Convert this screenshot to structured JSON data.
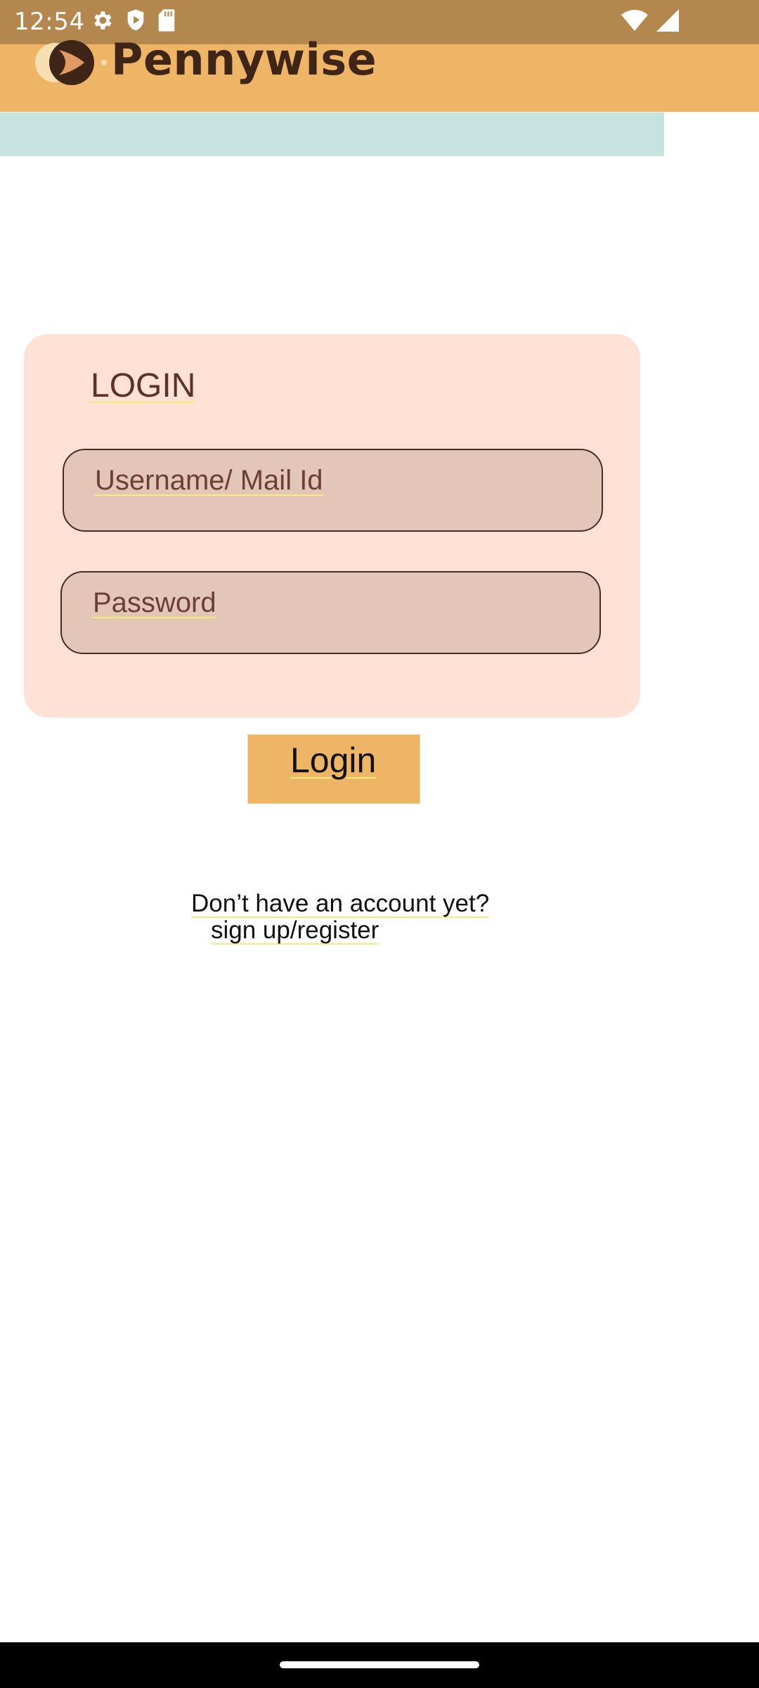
{
  "status_bar": {
    "time": "12:54",
    "left_icons": [
      "gear-icon",
      "shield-icon",
      "sd-card-icon"
    ],
    "right_icons": [
      "wifi-icon",
      "cell-signal-icon"
    ]
  },
  "app_header": {
    "title": "Pennywise",
    "logo": "pennywise-logo-icon"
  },
  "login_card": {
    "title": "LOGIN",
    "username_placeholder": "Username/ Mail Id",
    "password_placeholder": "Password"
  },
  "login_button": {
    "label": "Login"
  },
  "signup": {
    "prompt": "Don’t have an account yet?",
    "link": "sign up/register"
  },
  "colors": {
    "status_bar": "#b4874f",
    "header": "#efb567",
    "teal_strip": "#c6e3e0",
    "card": "#ffe1d6",
    "field": "#e4c6b8",
    "text_brown": "#3f2418"
  }
}
